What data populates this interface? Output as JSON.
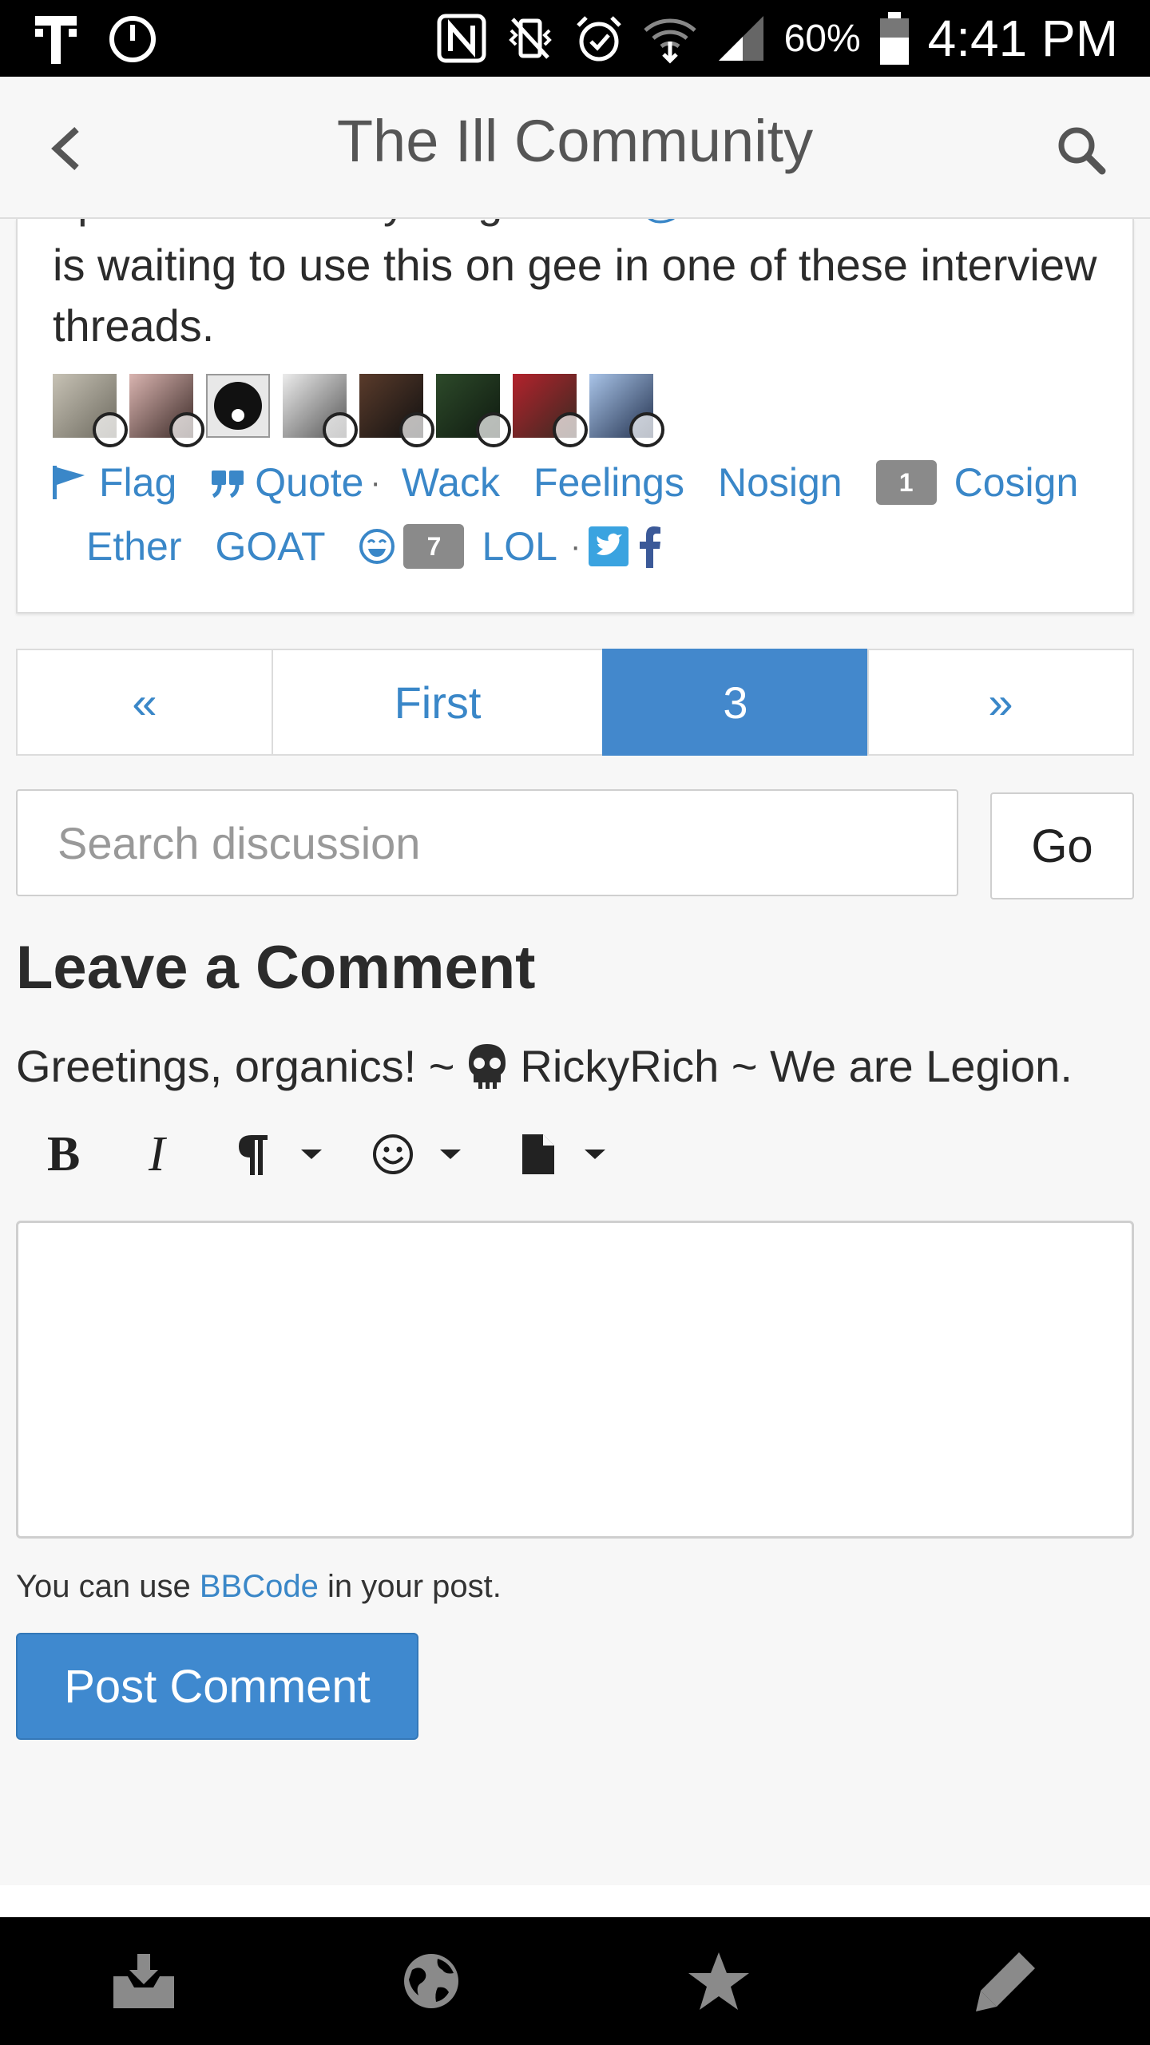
{
  "status_bar": {
    "battery": "60%",
    "time": "4:41 PM"
  },
  "header": {
    "title": "The Ill Community"
  },
  "post": {
    "cut_line_prefix": "I post it and everything . I bet",
    "cut_line_mention": "@",
    "text": "is waiting to use this on gee in one of these interview threads.",
    "avatar_count": 8
  },
  "reactions": {
    "flag": "Flag",
    "quote": "Quote",
    "separator": "·",
    "wack": "Wack",
    "feelings": "Feelings",
    "nosign": "Nosign",
    "cosign_count": "1",
    "cosign": "Cosign",
    "ether": "Ether",
    "goat": "GOAT",
    "lol_count": "7",
    "lol": "LOL"
  },
  "pager": {
    "prev": "«",
    "first": "First",
    "current": "3",
    "next": "»"
  },
  "search": {
    "placeholder": "Search discussion",
    "go": "Go"
  },
  "comment": {
    "title": "Leave a Comment",
    "greeting_before": "Greetings, organics! ~",
    "greeting_after": "RickyRich ~ We are Legion.",
    "hint_before": "You can use",
    "hint_link": "BBCode",
    "hint_after": "in your post.",
    "submit": "Post Comment"
  },
  "colors": {
    "accent": "#3a87c8",
    "active_page": "#4388cc",
    "badge": "#8a8a8a"
  }
}
